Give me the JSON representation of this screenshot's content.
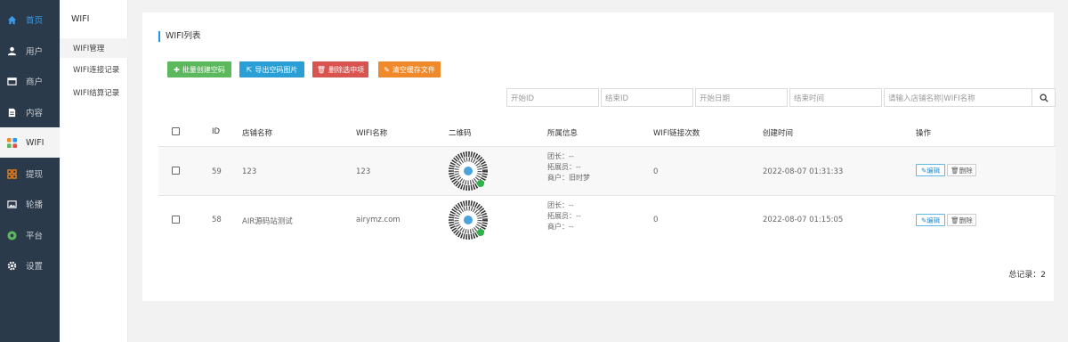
{
  "sidebar": {
    "items": [
      {
        "label": "首页",
        "icon": "home-icon"
      },
      {
        "label": "用户",
        "icon": "user-icon"
      },
      {
        "label": "商户",
        "icon": "store-icon"
      },
      {
        "label": "内容",
        "icon": "document-icon"
      },
      {
        "label": "WIFI",
        "icon": "wifi-icon"
      },
      {
        "label": "提现",
        "icon": "grid-icon"
      },
      {
        "label": "轮播",
        "icon": "image-icon"
      },
      {
        "label": "平台",
        "icon": "platform-icon"
      },
      {
        "label": "设置",
        "icon": "gear-icon"
      }
    ]
  },
  "subnav": {
    "title": "WIFI",
    "items": [
      "WIFI管理",
      "WIFI连接记录",
      "WIFI结算记录"
    ]
  },
  "panel": {
    "title": "WIFI列表",
    "buttons": {
      "batch_create": "批量创建空码",
      "export_images": "导出空码图片",
      "delete_selected": "删除选中项",
      "clear_cache": "清空缓存文件"
    },
    "filters": {
      "start_id": "开始ID",
      "end_id": "结束ID",
      "start_date": "开始日期",
      "end_date": "结束时间",
      "keyword": "请输入店铺名称|WIFI名称"
    },
    "table": {
      "headers": [
        "ID",
        "店铺名称",
        "WIFI名称",
        "二维码",
        "所属信息",
        "WIFI链接次数",
        "创建时间",
        "操作"
      ],
      "rows": [
        {
          "id": "59",
          "store": "123",
          "wifi": "123",
          "info": [
            "团长：--",
            "拓展员：--",
            "商户：旧时梦"
          ],
          "count": "0",
          "created": "2022-08-07 01:31:33"
        },
        {
          "id": "58",
          "store": "AIR源码站测试",
          "wifi": "airymz.com",
          "info": [
            "团长：--",
            "拓展员：--",
            "商户：--"
          ],
          "count": "0",
          "created": "2022-08-07 01:15:05"
        }
      ],
      "edit_label": "编辑",
      "delete_label": "删除"
    },
    "total": "总记录：2"
  },
  "colors": {
    "sidebar_bg": "#2b3a4a",
    "accent": "#2196f3",
    "btn_green": "#5cb85c",
    "btn_blue": "#2a9fd6",
    "btn_red": "#d9534f",
    "btn_orange": "#f0892b"
  }
}
